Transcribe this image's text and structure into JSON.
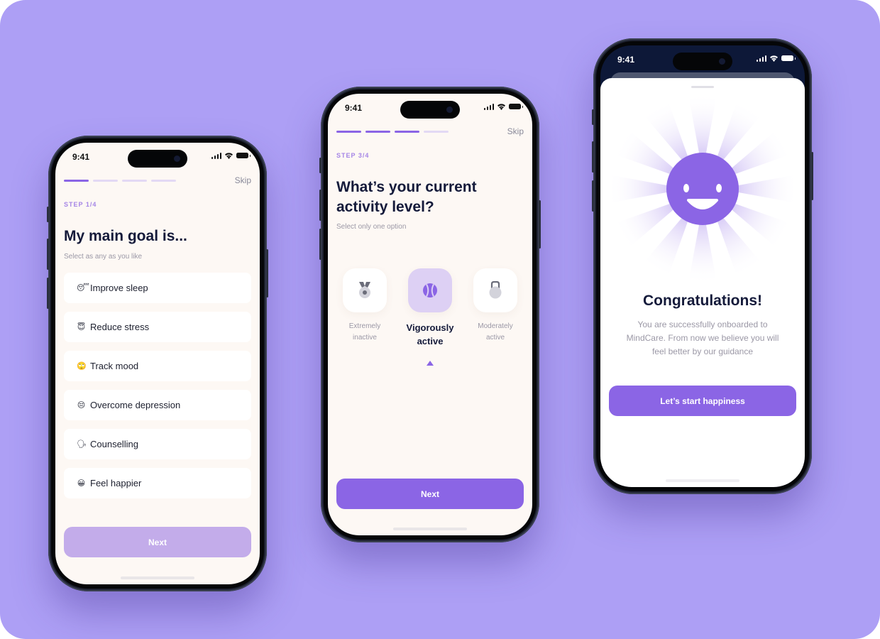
{
  "brand": {
    "accent": "#8b65e5",
    "accent_disabled": "#c3acea",
    "background": "#ad9ff5"
  },
  "phones": [
    {
      "status": {
        "time": "9:41"
      },
      "progress": {
        "current_step": 1,
        "total_steps": 4
      },
      "skip_label": "Skip",
      "step_label": "STEP 1/4",
      "title": "My main goal is...",
      "subtitle": "Select as any as you like",
      "options": [
        {
          "emoji": "😴",
          "label": "Improve sleep"
        },
        {
          "emoji": "😇",
          "label": "Reduce stress"
        },
        {
          "emoji": "🙄",
          "label": "Track mood"
        },
        {
          "emoji": "😔",
          "label": "Overcome depression"
        },
        {
          "emoji": "🗣",
          "label": "Counselling"
        },
        {
          "emoji": "😀",
          "label": "Feel happier"
        }
      ],
      "next_label": "Next",
      "next_enabled": false
    },
    {
      "status": {
        "time": "9:41"
      },
      "progress": {
        "current_step": 3,
        "total_steps": 4
      },
      "skip_label": "Skip",
      "step_label": "STEP 3/4",
      "title_line1": "What’s your current",
      "title_line2": "activity level?",
      "subtitle": "Select only one option",
      "activities": [
        {
          "icon": "medal-icon",
          "line1": "Extremely",
          "line2": "inactive",
          "selected": false
        },
        {
          "icon": "tennis-ball-icon",
          "line1": "Vigorously",
          "line2": "active",
          "selected": true
        },
        {
          "icon": "kettlebell-icon",
          "line1": "Moderately",
          "line2": "active",
          "selected": false
        }
      ],
      "next_label": "Next",
      "next_enabled": true
    },
    {
      "status": {
        "time": "9:41"
      },
      "icon": "smiley-face-icon",
      "title": "Congratulations!",
      "body_line1": "You are successfully onboarded to",
      "body_line2": "MindCare. From now we believe you will",
      "body_line3": "feel better by our guidance",
      "cta_label": "Let’s start happiness"
    }
  ]
}
